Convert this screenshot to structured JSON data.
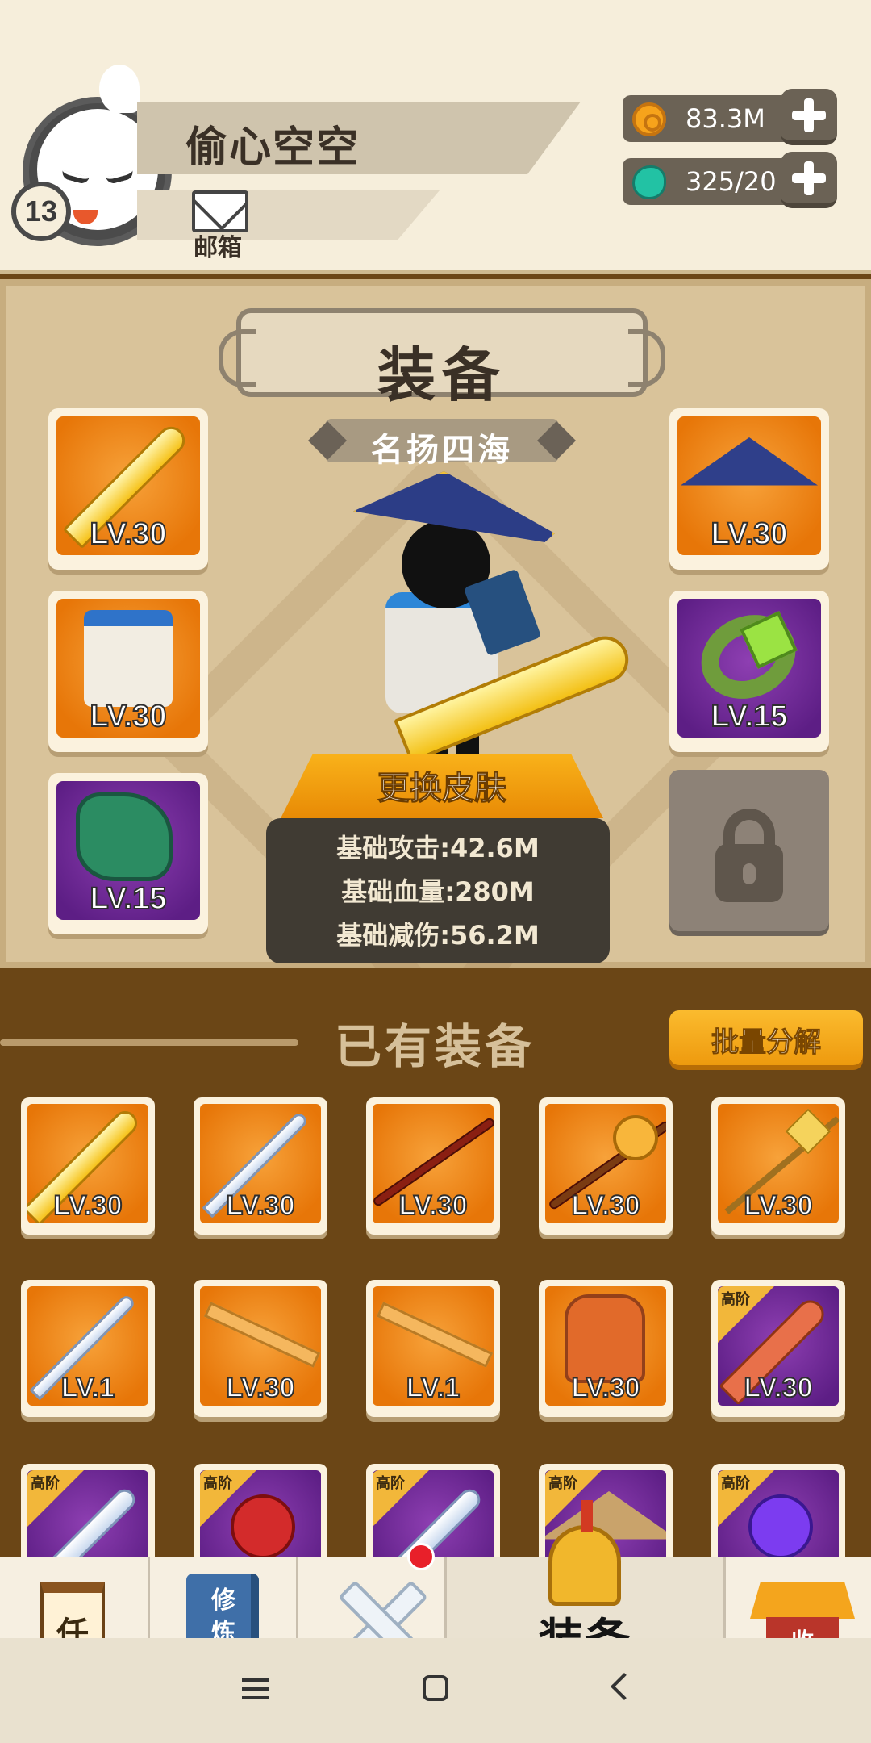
{
  "header": {
    "player_name": "偷心空空",
    "level": "13",
    "mail_label": "邮箱",
    "gold": "83.3M",
    "gems": "325/20"
  },
  "equip": {
    "title": "装备",
    "rank_title": "名扬四海",
    "change_skin": "更换皮肤",
    "stats": [
      "基础攻击:42.6M",
      "基础血量:280M",
      "基础减伤:56.2M"
    ],
    "left_slots": [
      {
        "name": "weapon",
        "level": "LV.30",
        "rarity": "orange"
      },
      {
        "name": "armor",
        "level": "LV.30",
        "rarity": "orange"
      },
      {
        "name": "boots",
        "level": "LV.15",
        "rarity": "purple"
      }
    ],
    "right_slots": [
      {
        "name": "hat",
        "level": "LV.30",
        "rarity": "orange"
      },
      {
        "name": "ring",
        "level": "LV.15",
        "rarity": "purple"
      }
    ]
  },
  "owned": {
    "title": "已有装备",
    "batch_button": "批量分解",
    "tier_label": "高阶",
    "rows": [
      [
        "LV.30",
        "LV.30",
        "LV.30",
        "LV.30",
        "LV.30"
      ],
      [
        "LV.1",
        "LV.30",
        "LV.1",
        "LV.30",
        "LV.30"
      ]
    ]
  },
  "nav": {
    "task_char": "任",
    "cultivate_text": "修炼",
    "active_label": "装备",
    "shop_char": "收"
  },
  "colors": {
    "orange_tier": "#e77608",
    "purple_tier": "#5d1e85",
    "panel_bg": "#d9c39a",
    "owned_bg": "#6b4616"
  },
  "icons": [
    "coin-icon",
    "jade-icon",
    "plus-icon",
    "mail-icon",
    "lock-icon",
    "menu-icon",
    "home-icon",
    "back-icon"
  ]
}
